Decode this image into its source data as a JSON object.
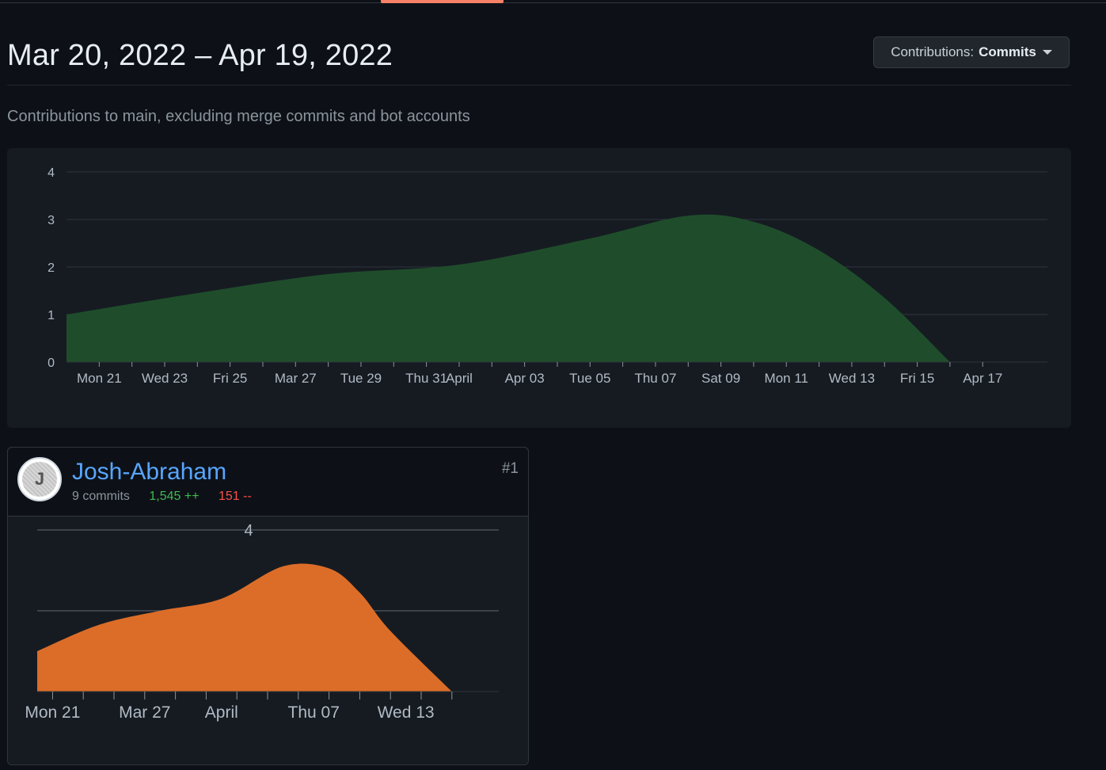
{
  "header": {
    "date_range": "Mar 20, 2022 – Apr 19, 2022",
    "contributions_label": "Contributions:",
    "contributions_value": "Commits",
    "subtitle": "Contributions to main, excluding merge commits and bot accounts"
  },
  "colors": {
    "background": "#0d1117",
    "panel": "#161b22",
    "main_area_fill": "#1f4d2b",
    "contributor_area_fill": "#dc6d28",
    "link": "#58a6ff",
    "additions": "#3fb950",
    "deletions": "#f85149",
    "tab_accent": "#f78166"
  },
  "chart_data": [
    {
      "type": "area",
      "series": [
        {
          "x": [
            "2022-03-20",
            "2022-03-24",
            "2022-03-28",
            "2022-04-01",
            "2022-04-05",
            "2022-04-08",
            "2022-04-10",
            "2022-04-12",
            "2022-04-14",
            "2022-04-16"
          ],
          "values": [
            1,
            1.45,
            1.85,
            2.05,
            2.6,
            3.08,
            2.95,
            2.35,
            1.35,
            0
          ]
        }
      ],
      "ylim": [
        0,
        4
      ],
      "yticks": [
        "0",
        "1",
        "2",
        "3",
        "4"
      ],
      "xtick_labels": [
        "Mon 21",
        "Wed 23",
        "Fri 25",
        "Mar 27",
        "Tue 29",
        "Thu 31",
        "April",
        "Apr 03",
        "Tue 05",
        "Thu 07",
        "Sat 09",
        "Mon 11",
        "Wed 13",
        "Fri 15",
        "Apr 17"
      ],
      "grid": true
    },
    {
      "type": "area",
      "series": [
        {
          "x": [
            "2022-03-20",
            "2022-03-24",
            "2022-03-28",
            "2022-04-01",
            "2022-04-05",
            "2022-04-08",
            "2022-04-10",
            "2022-04-12",
            "2022-04-16"
          ],
          "values": [
            1,
            1.65,
            2.0,
            2.3,
            3.1,
            3.05,
            2.45,
            1.5,
            0
          ]
        }
      ],
      "ylim": [
        0,
        4
      ],
      "yticks": [
        "4"
      ],
      "xtick_labels": [
        "Mon 21",
        "Mar 27",
        "April",
        "Thu 07",
        "Wed 13"
      ],
      "grid": true
    }
  ],
  "contributors": [
    {
      "name": "Josh-Abraham",
      "avatar_initial": "J",
      "commits": "9 commits",
      "additions": "1,545 ++",
      "deletions": "151 --",
      "rank": "#1"
    }
  ]
}
